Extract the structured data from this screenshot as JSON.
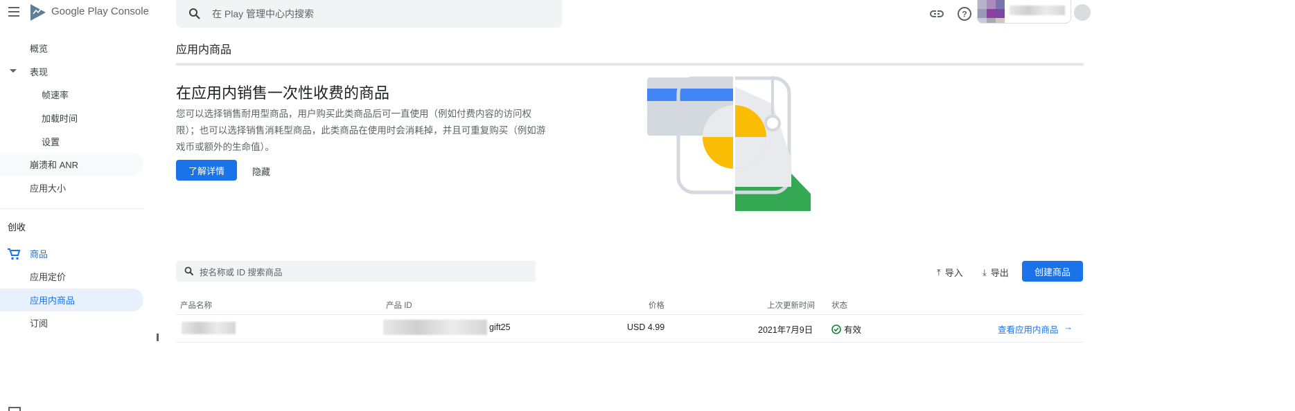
{
  "header": {
    "brand_google": "Google Play",
    "brand_console": "Console",
    "search_placeholder": "在 Play 管理中心内搜索"
  },
  "sidebar": {
    "items": [
      {
        "label": "概览"
      },
      {
        "label": "表现"
      },
      {
        "label": "帧速率"
      },
      {
        "label": "加载时间"
      },
      {
        "label": "设置"
      },
      {
        "label": "崩溃和 ANR"
      },
      {
        "label": "应用大小"
      }
    ],
    "section": "创收",
    "monetize_items": [
      {
        "label": "商品"
      },
      {
        "label": "应用定价"
      },
      {
        "label": "应用内商品"
      },
      {
        "label": "订阅"
      }
    ]
  },
  "page": {
    "title": "应用内商品"
  },
  "hero": {
    "title": "在应用内销售一次性收费的商品",
    "description": "您可以选择销售耐用型商品，用户购买此类商品后可一直使用（例如付费内容的访问权限）；也可以选择销售消耗型商品，此类商品在使用时会消耗掉，并且可重复购买（例如游戏币或额外的生命值）。",
    "learn_more": "了解详情",
    "hide": "隐藏"
  },
  "toolbar": {
    "search_placeholder": "按名称或 ID 搜索商品",
    "import": "导入",
    "export": "导出",
    "create": "创建商品"
  },
  "table": {
    "headers": [
      "产品名称",
      "产品 ID",
      "价格",
      "上次更新时间",
      "状态"
    ],
    "rows": [
      {
        "id_suffix": "gift25",
        "price": "USD 4.99",
        "updated": "2021年7月9日",
        "status": "有效",
        "action": "查看应用内商品"
      }
    ]
  },
  "colors": {
    "accent": "#1a73e8",
    "success": "#188038",
    "green": "#34a853",
    "yellow": "#fbbc04"
  }
}
